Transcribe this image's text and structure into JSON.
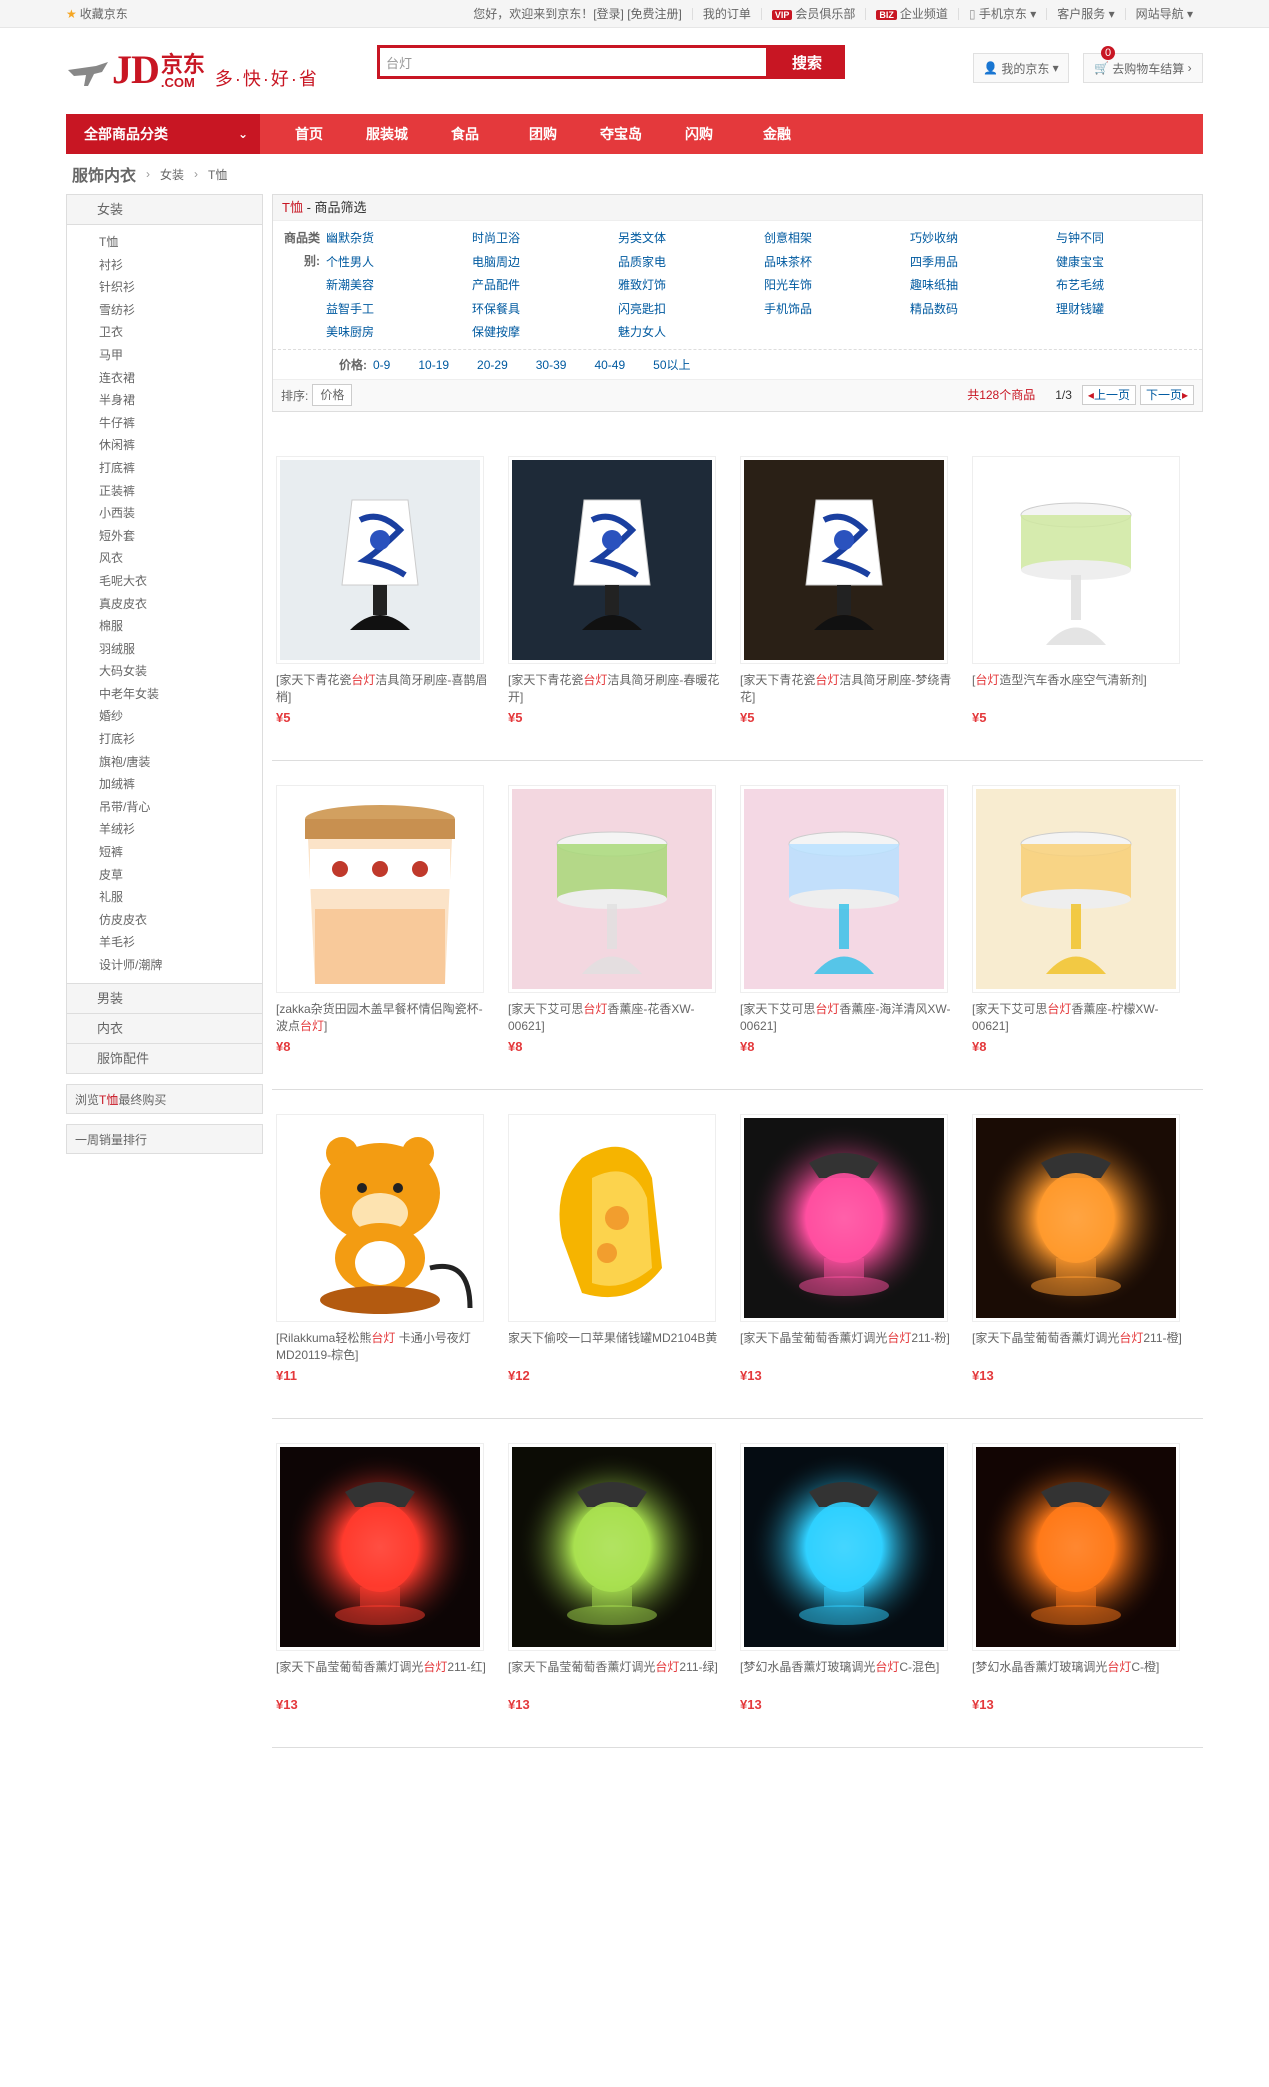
{
  "topbar": {
    "favorite": "收藏京东",
    "links": [
      "您好，欢迎来到京东！[登录] [免费注册]",
      "我的订单",
      "会员俱乐部",
      "企业频道",
      "手机京东",
      "客户服务",
      "网站导航"
    ],
    "vip_badge": "VIP",
    "biz_badge": "BIZ"
  },
  "header": {
    "logo_jd": "JD",
    "logo_cn": "京东",
    "logo_com": ".COM",
    "slogan": "多·快·好·省",
    "search_value": "台灯",
    "search_button": "搜索",
    "myjd": "我的京东",
    "cart": "去购物车结算",
    "cart_count": "0"
  },
  "nav": {
    "all_categories": "全部商品分类",
    "items": [
      "首页",
      "服装城",
      "食品",
      "团购",
      "夺宝岛",
      "闪购",
      "金融"
    ]
  },
  "breadcrumb": {
    "main": "服饰内衣",
    "level2": "女装",
    "level3": "T恤"
  },
  "sidebar": {
    "head": "女装",
    "items": [
      "T恤",
      "衬衫",
      "针织衫",
      "雪纺衫",
      "卫衣",
      "马甲",
      "连衣裙",
      "半身裙",
      "牛仔裤",
      "休闲裤",
      "打底裤",
      "正装裤",
      "小西装",
      "短外套",
      "风衣",
      "毛呢大衣",
      "真皮皮衣",
      "棉服",
      "羽绒服",
      "大码女装",
      "中老年女装",
      "婚纱",
      "打底衫",
      "旗袍/唐装",
      "加绒裤",
      "吊带/背心",
      "羊绒衫",
      "短裤",
      "皮草",
      "礼服",
      "仿皮皮衣",
      "羊毛衫",
      "设计师/潮牌"
    ],
    "cats": [
      "男装",
      "内衣",
      "服饰配件"
    ],
    "ext1_prefix": "浏览",
    "ext1_kw": "T恤",
    "ext1_suffix": "最终购买",
    "ext2": "一周销量排行"
  },
  "filter": {
    "title_kw": "T恤",
    "title_rest": " - 商品筛选",
    "cat_label": "商品类别:",
    "cats": [
      "幽默杂货",
      "时尚卫浴",
      "另类文体",
      "创意相架",
      "巧妙收纳",
      "与钟不同",
      "个性男人",
      "电脑周边",
      "品质家电",
      "品味茶杯",
      "四季用品",
      "健康宝宝",
      "新潮美容",
      "产品配件",
      "雅致灯饰",
      "阳光车饰",
      "趣味纸抽",
      "布艺毛绒",
      "益智手工",
      "环保餐具",
      "闪亮匙扣",
      "手机饰品",
      "精品数码",
      "理财钱罐",
      "美味厨房",
      "保健按摩",
      "魅力女人"
    ],
    "price_label": "价格:",
    "prices": [
      "0-9",
      "10-19",
      "20-29",
      "30-39",
      "40-49",
      "50以上"
    ],
    "sort_label": "排序:",
    "sort_price": "价格",
    "total": "共128个商品",
    "page": "1/3",
    "prev": "上一页",
    "next": "下一页"
  },
  "products": [
    {
      "pre": "[家天下青花瓷",
      "kw": "台灯",
      "post": "洁具简牙刷座-喜鹊眉梢]",
      "price": "¥5",
      "img": "lamp-blue"
    },
    {
      "pre": "[家天下青花瓷",
      "kw": "台灯",
      "post": "洁具简牙刷座-春暖花开]",
      "price": "¥5",
      "img": "lamp-blue-dark"
    },
    {
      "pre": "[家天下青花瓷",
      "kw": "台灯",
      "post": "洁具简牙刷座-梦绕青花]",
      "price": "¥5",
      "img": "lamp-blue-black"
    },
    {
      "pre": "[",
      "kw": "台灯",
      "post": "造型汽车香水座空气清新剂]",
      "price": "¥5",
      "img": "lamp-lime"
    },
    {
      "pre": "[zakka杂货田园木盖早餐杯情侣陶瓷杯-波点",
      "kw": "台灯",
      "post": "]",
      "price": "¥8",
      "img": "mug"
    },
    {
      "pre": "[家天下艾可思",
      "kw": "台灯",
      "post": "香薰座-花香XW-00621]",
      "price": "¥8",
      "img": "lamp-green"
    },
    {
      "pre": "[家天下艾可思",
      "kw": "台灯",
      "post": "香薰座-海洋清风XW-00621]",
      "price": "¥8",
      "img": "lamp-cyan"
    },
    {
      "pre": "[家天下艾可思",
      "kw": "台灯",
      "post": "香薰座-柠檬XW-00621]",
      "price": "¥8",
      "img": "lamp-yellow"
    },
    {
      "pre": "[Rilakkuma轻松熊",
      "kw": "台灯",
      "post": " 卡通小号夜灯MD20119-棕色]",
      "price": "¥11",
      "img": "bear"
    },
    {
      "pre": "家天下偷咬一口苹果储钱罐MD2104B黄",
      "kw": "",
      "post": "",
      "price": "¥12",
      "img": "apple"
    },
    {
      "pre": "[家天下晶莹葡萄香薰灯调光",
      "kw": "台灯",
      "post": "211-粉]",
      "price": "¥13",
      "img": "glow-pink"
    },
    {
      "pre": "[家天下晶莹葡萄香薰灯调光",
      "kw": "台灯",
      "post": "211-橙]",
      "price": "¥13",
      "img": "glow-orange"
    },
    {
      "pre": "[家天下晶莹葡萄香薰灯调光",
      "kw": "台灯",
      "post": "211-红]",
      "price": "¥13",
      "img": "glow-red"
    },
    {
      "pre": "[家天下晶莹葡萄香薰灯调光",
      "kw": "台灯",
      "post": "211-绿]",
      "price": "¥13",
      "img": "glow-green"
    },
    {
      "pre": "[梦幻水晶香薰灯玻璃调光",
      "kw": "台灯",
      "post": "C-混色]",
      "price": "¥13",
      "img": "glow-cyan"
    },
    {
      "pre": "[梦幻水晶香薰灯玻璃调光",
      "kw": "台灯",
      "post": "C-橙]",
      "price": "¥13",
      "img": "glow-amber"
    }
  ],
  "colors": {
    "brand": "#c81623",
    "nav": "#e4393c",
    "link": "#005aa0"
  }
}
